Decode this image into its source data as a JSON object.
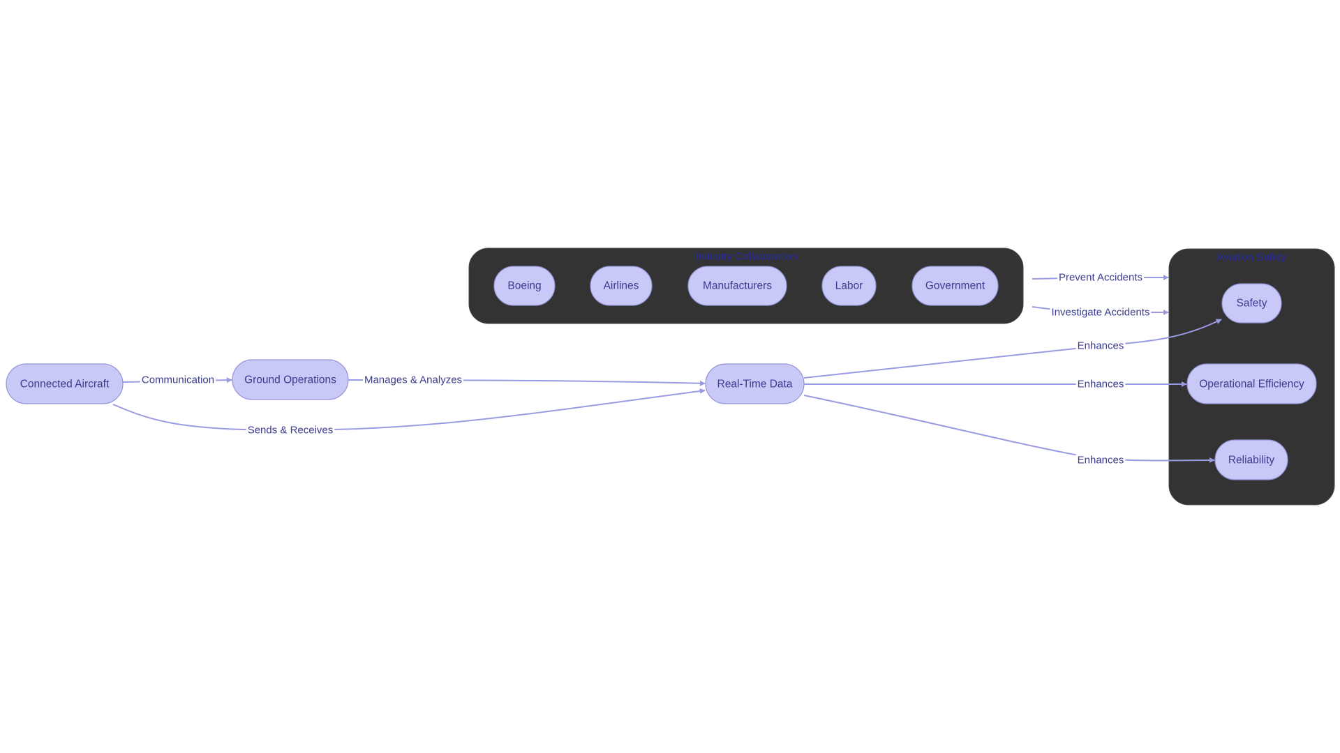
{
  "diagram": {
    "type": "flowchart",
    "colors": {
      "node_fill": "#c9c9f8",
      "node_stroke": "#9393d8",
      "node_text": "#3b3b8f",
      "edge": "#9a9ae2",
      "cluster_fill": "#333333",
      "cluster_title": "#2a2aa8",
      "background": "#ffffff"
    },
    "clusters": [
      {
        "id": "industry",
        "title": "Industry Collaboration",
        "members": [
          "boeing",
          "airlines",
          "manufacturers",
          "labor",
          "government"
        ]
      },
      {
        "id": "safety_group",
        "title": "Aviation Safety",
        "members": [
          "safety",
          "efficiency",
          "reliability"
        ]
      }
    ],
    "nodes": [
      {
        "id": "aircraft",
        "label": "Connected Aircraft"
      },
      {
        "id": "ground",
        "label": "Ground Operations"
      },
      {
        "id": "realtime",
        "label": "Real-Time Data"
      },
      {
        "id": "boeing",
        "label": "Boeing"
      },
      {
        "id": "airlines",
        "label": "Airlines"
      },
      {
        "id": "manufacturers",
        "label": "Manufacturers"
      },
      {
        "id": "labor",
        "label": "Labor"
      },
      {
        "id": "government",
        "label": "Government"
      },
      {
        "id": "safety",
        "label": "Safety"
      },
      {
        "id": "efficiency",
        "label": "Operational Efficiency"
      },
      {
        "id": "reliability",
        "label": "Reliability"
      }
    ],
    "edges": [
      {
        "id": "e1",
        "from": "aircraft",
        "to": "ground",
        "label": "Communication"
      },
      {
        "id": "e2",
        "from": "ground",
        "to": "realtime",
        "label": "Manages & Analyzes"
      },
      {
        "id": "e3",
        "from": "aircraft",
        "to": "realtime",
        "label": "Sends & Receives"
      },
      {
        "id": "e4",
        "from": "realtime",
        "to": "safety",
        "label": "Enhances"
      },
      {
        "id": "e5",
        "from": "realtime",
        "to": "efficiency",
        "label": "Enhances"
      },
      {
        "id": "e6",
        "from": "realtime",
        "to": "reliability",
        "label": "Enhances"
      },
      {
        "id": "e7",
        "from": "industry",
        "to": "safety_group",
        "label": "Prevent Accidents"
      },
      {
        "id": "e8",
        "from": "industry",
        "to": "safety_group",
        "label": "Investigate Accidents"
      }
    ]
  }
}
